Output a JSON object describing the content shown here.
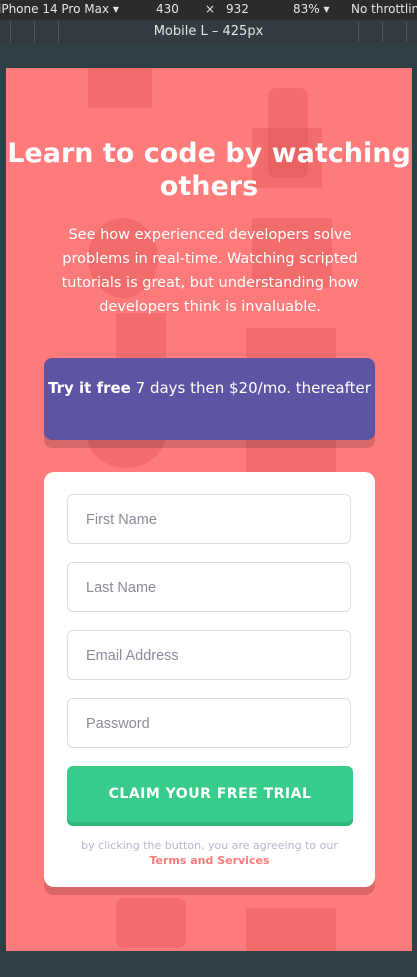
{
  "devtools": {
    "device": "iPhone 14 Pro Max",
    "width": "430",
    "times": "×",
    "height": "932",
    "zoom": "83%",
    "throttle": "No throttling",
    "breakpoint": "Mobile L – 425px"
  },
  "hero": {
    "title": "Learn to code by watching others",
    "subtitle": "See how experienced developers solve problems in real-time. Watching scripted tutorials is great, but understanding how developers think is invaluable."
  },
  "trial": {
    "bold": "Try it free",
    "text": " 7 days then $20/mo. thereafter"
  },
  "form": {
    "first_name_placeholder": "First Name",
    "last_name_placeholder": "Last Name",
    "email_placeholder": "Email Address",
    "password_placeholder": "Password",
    "submit_label": "CLAIM YOUR FREE TRIAL",
    "terms_text": "by clicking the button, you are agreeing to our",
    "terms_link": "Terms and Services"
  },
  "colors": {
    "background": "#ff7a7a",
    "trial": "#5e54a4",
    "submit": "#38cc8c"
  }
}
